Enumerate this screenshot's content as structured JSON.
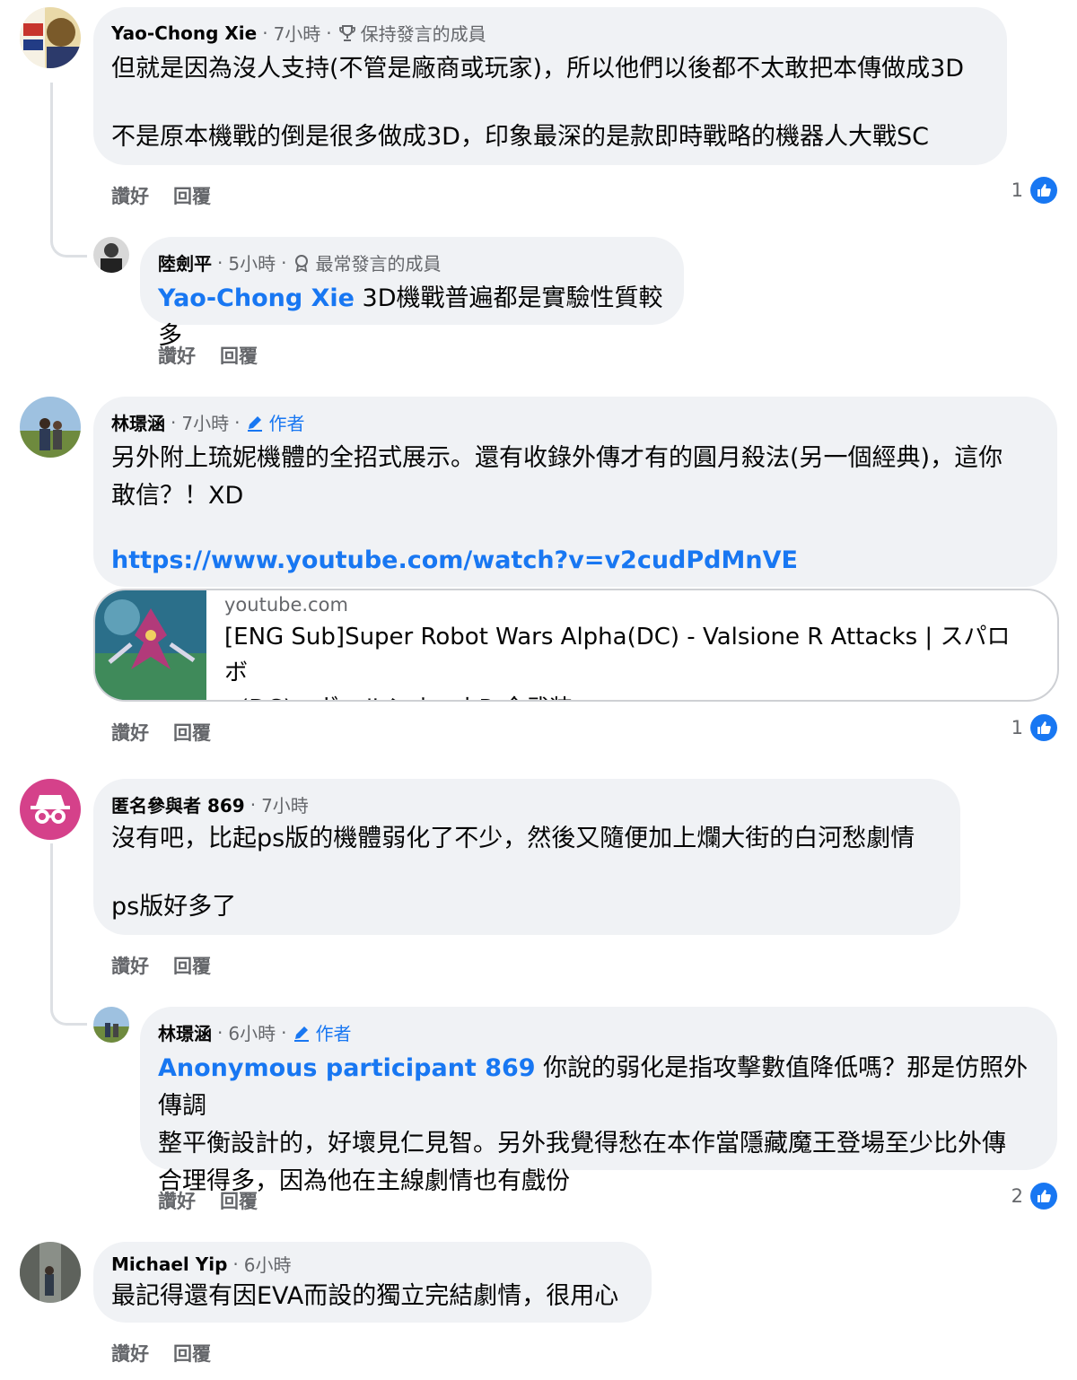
{
  "comments": [
    {
      "author": "Yao-Chong Xie",
      "time": "7小時",
      "badge": "保持發言的成員",
      "badge_icon": "trophy-icon",
      "lines": [
        "但就是因為沒人支持(不管是廠商或玩家)，所以他們以後都不太敢把本傳做成3D",
        "不是原本機戰的倒是很多做成3D，印象最深的是款即時戰略的機器人大戰SC"
      ],
      "like_label": "讚好",
      "reply_label": "回覆",
      "like_count": "1"
    },
    {
      "author": "陸劍平",
      "time": "5小時",
      "badge": "最常發言的成員",
      "badge_icon": "top-contributor-icon",
      "mention": "Yao-Chong Xie",
      "text": " 3D機戰普遍都是實驗性質較多",
      "like_label": "讚好",
      "reply_label": "回覆"
    },
    {
      "author": "林璟涵",
      "time": "7小時",
      "badge": "作者",
      "badge_icon": "pencil-icon",
      "lines": [
        "另外附上琉妮機體的全招式展示。還有收錄外傳才有的圓月殺法(另一個經典)，這你",
        "敢信？！XD"
      ],
      "link": "https://www.youtube.com/watch?v=v2cudPdMnVE",
      "preview": {
        "domain": "youtube.com",
        "title_lines": [
          "[ENG Sub]Super Robot Wars Alpha(DC) - Valsione R Attacks | スパロボ",
          "α(DC) - ヴァルシオーネR 全武装"
        ]
      },
      "like_label": "讚好",
      "reply_label": "回覆",
      "like_count": "1"
    },
    {
      "author": "匿名參與者 869",
      "time": "7小時",
      "lines": [
        "沒有吧，比起ps版的機體弱化了不少，然後又隨便加上爛大街的白河愁劇情",
        "ps版好多了"
      ],
      "like_label": "讚好",
      "reply_label": "回覆"
    },
    {
      "author": "林璟涵",
      "time": "6小時",
      "badge": "作者",
      "badge_icon": "pencil-icon",
      "mention": "Anonymous participant 869",
      "line1_rest": " 你說的弱化是指攻擊數值降低嗎？那是仿照外傳調",
      "lines": [
        "整平衡設計的，好壞見仁見智。另外我覺得愁在本作當隱藏魔王登場至少比外傳",
        "合理得多，因為他在主線劇情也有戲份"
      ],
      "like_label": "讚好",
      "reply_label": "回覆",
      "like_count": "2"
    },
    {
      "author": "Michael Yip",
      "time": "6小時",
      "text": "最記得還有因EVA而設的獨立完結劇情，很用心",
      "like_label": "讚好",
      "reply_label": "回覆"
    }
  ],
  "separator": "·",
  "colors": {
    "accent": "#1877f2",
    "bubble": "#f0f2f5",
    "anon_avatar": "#d5418a"
  }
}
